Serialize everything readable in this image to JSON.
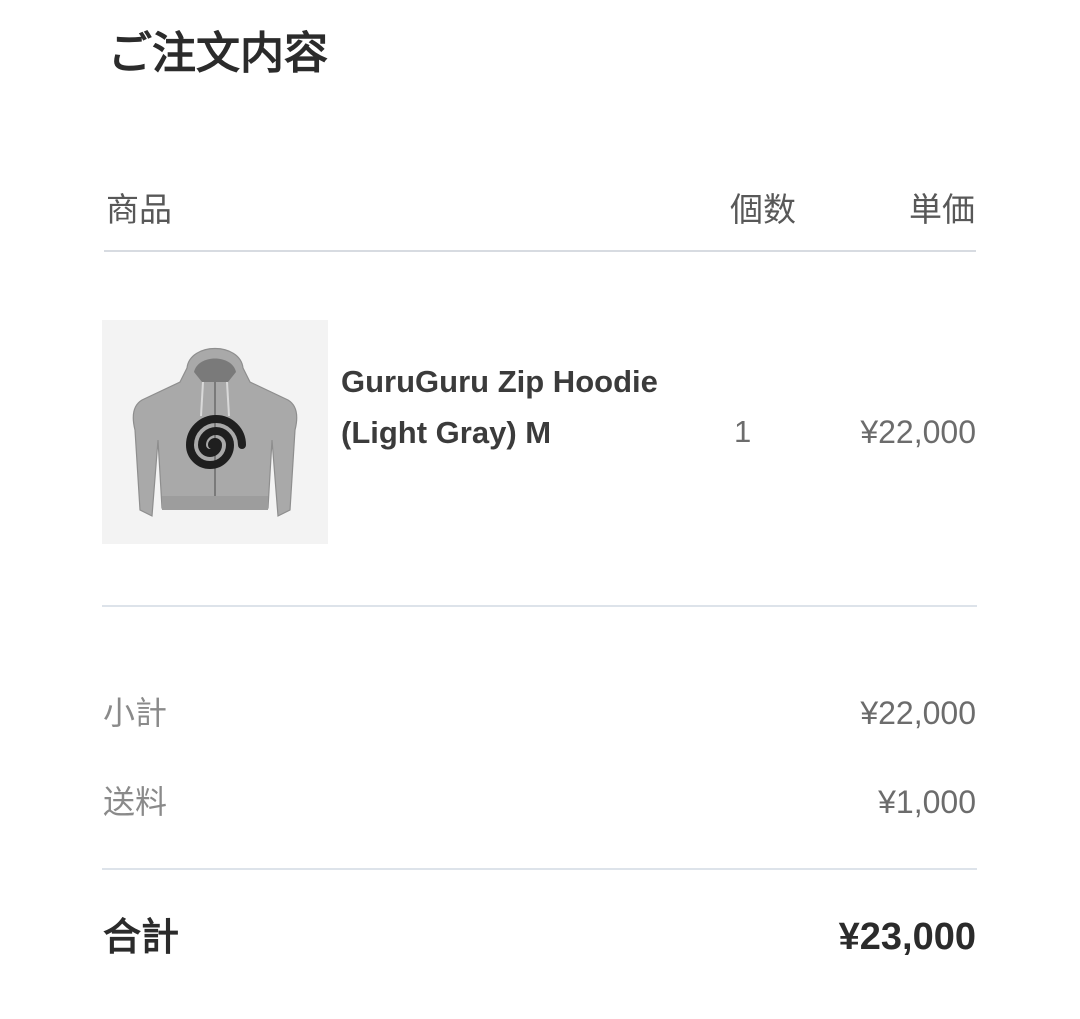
{
  "page": {
    "title": "ご注文内容"
  },
  "table_header": {
    "product": "商品",
    "quantity": "個数",
    "unit_price": "単価"
  },
  "items": [
    {
      "name": "GuruGuru Zip Hoodie (Light Gray) M",
      "quantity": "1",
      "unit_price": "¥22,000",
      "thumbnail_icon": "gray-zip-hoodie-with-black-spiral-print"
    }
  ],
  "summary": {
    "subtotal_label": "小計",
    "subtotal_value": "¥22,000",
    "shipping_label": "送料",
    "shipping_value": "¥1,000",
    "total_label": "合計",
    "total_value": "¥23,000"
  },
  "colors": {
    "text_dark": "#2b2b2b",
    "text_gray": "#6c6c6c",
    "rule": "#d7dbe1"
  }
}
